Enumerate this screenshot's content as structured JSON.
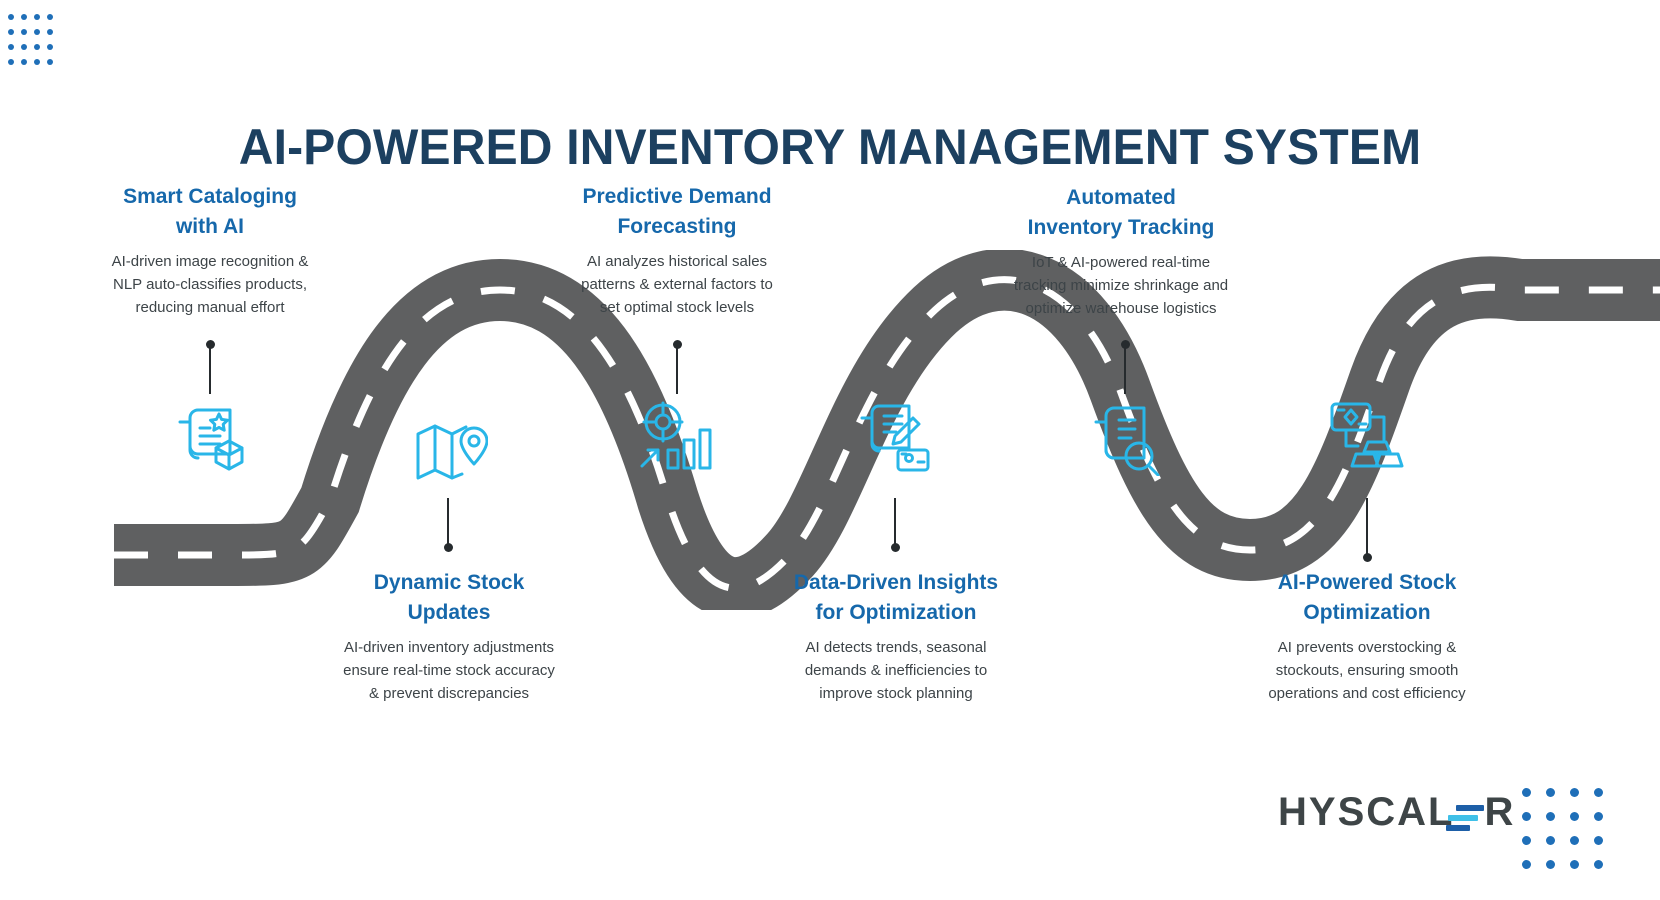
{
  "page": {
    "title": "AI-POWERED INVENTORY MANAGEMENT SYSTEM",
    "background_color": "#ffffff",
    "title_color": "#1c4060",
    "heading_color": "#1668ab",
    "body_color": "#3d4448",
    "road_color": "#5f6061",
    "road_dash_color": "#ffffff",
    "icon_color": "#29b6e8",
    "connector_color": "#262b2e",
    "dot_grid_color": "#1f6fb8"
  },
  "steps": [
    {
      "id": "smart-cataloging",
      "position": "top",
      "title": "Smart Cataloging with AI",
      "title_lines": [
        "Smart Cataloging",
        "with AI"
      ],
      "description": "AI-driven image recognition & NLP auto-classifies products, reducing manual effort",
      "description_lines": [
        "AI-driven image recognition &",
        "NLP auto-classifies products,",
        "reducing manual effort"
      ],
      "icon": "document-star-box-icon"
    },
    {
      "id": "dynamic-stock-updates",
      "position": "bottom",
      "title": "Dynamic Stock Updates",
      "title_lines": [
        "Dynamic Stock",
        "Updates"
      ],
      "description": "AI-driven inventory adjustments ensure real-time stock accuracy & prevent discrepancies",
      "description_lines": [
        "AI-driven inventory adjustments",
        "ensure real-time stock accuracy",
        "& prevent discrepancies"
      ],
      "icon": "map-location-pin-icon"
    },
    {
      "id": "predictive-demand-forecasting",
      "position": "top",
      "title": "Predictive Demand Forecasting",
      "title_lines": [
        "Predictive Demand",
        "Forecasting"
      ],
      "description": "AI analyzes historical sales patterns & external factors to set optimal stock levels",
      "description_lines": [
        "AI analyzes historical sales",
        "patterns & external factors to",
        "set optimal stock levels"
      ],
      "icon": "target-growth-chart-icon"
    },
    {
      "id": "data-driven-insights",
      "position": "bottom",
      "title": "Data-Driven Insights for Optimization",
      "title_lines": [
        "Data-Driven Insights",
        "for Optimization"
      ],
      "description": "AI detects trends, seasonal demands & inefficiencies to improve stock planning",
      "description_lines": [
        "AI detects trends, seasonal",
        "demands & inefficiencies to",
        "improve stock planning"
      ],
      "icon": "document-edit-card-icon"
    },
    {
      "id": "automated-inventory-tracking",
      "position": "top",
      "title": "Automated Inventory Tracking",
      "title_lines": [
        "Automated",
        "Inventory Tracking"
      ],
      "description": "IoT & AI-powered real-time tracking minimize shrinkage and optimize warehouse logistics",
      "description_lines": [
        "IoT & AI-powered real-time",
        "tracking minimize shrinkage and",
        "optimize warehouse logistics"
      ],
      "icon": "document-search-icon"
    },
    {
      "id": "ai-powered-stock-optimization",
      "position": "bottom",
      "title": "AI-Powered Stock Optimization",
      "title_lines": [
        "AI-Powered Stock",
        "Optimization"
      ],
      "description": "AI prevents overstocking & stockouts, ensuring smooth operations and cost efficiency",
      "description_lines": [
        "AI prevents overstocking &",
        "stockouts, ensuring smooth",
        "operations and cost efficiency"
      ],
      "icon": "inventory-network-icon"
    }
  ],
  "logo": {
    "text_before": "HYSCAL",
    "text_after": "R",
    "full_name": "HYSCALER"
  }
}
